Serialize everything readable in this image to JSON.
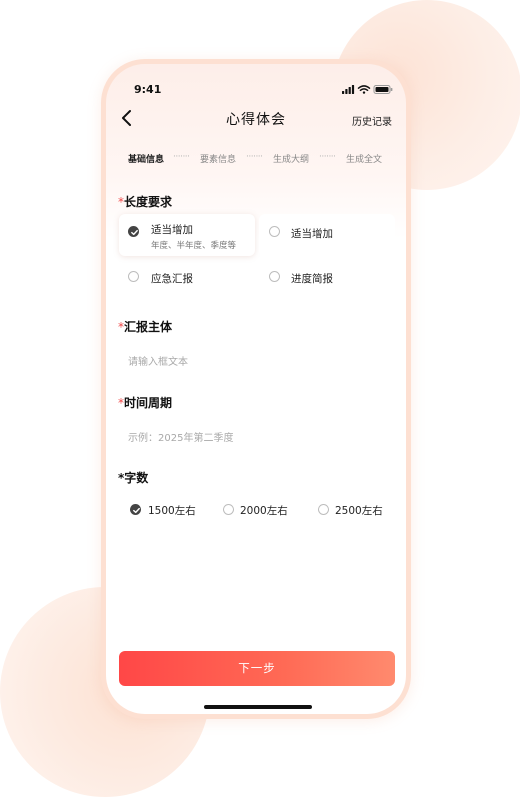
{
  "status": {
    "time": "9:41"
  },
  "nav": {
    "title": "心得体会",
    "history": "历史记录"
  },
  "steps": [
    {
      "label": "基础信息",
      "active": true
    },
    {
      "label": "要素信息",
      "active": false
    },
    {
      "label": "生成大纲",
      "active": false
    },
    {
      "label": "生成全文",
      "active": false
    }
  ],
  "step_separator": "·······",
  "required_mark": "*",
  "length": {
    "label": "长度要求",
    "options": [
      {
        "label": "适当增加",
        "sub": "年度、半年度、季度等",
        "selected": true
      },
      {
        "label": "适当增加",
        "selected": false
      },
      {
        "label": "应急汇报",
        "selected": false
      },
      {
        "label": "进度简报",
        "selected": false
      }
    ]
  },
  "subject": {
    "label": "汇报主体",
    "placeholder": "请输入框文本"
  },
  "period": {
    "label": "时间周期",
    "placeholder": "示例：2025年第二季度"
  },
  "wordcount": {
    "label": "字数",
    "options": [
      {
        "label": "1500左右",
        "selected": true
      },
      {
        "label": "2000左右",
        "selected": false
      },
      {
        "label": "2500左右",
        "selected": false
      }
    ]
  },
  "next_button": "下一步",
  "colors": {
    "accent": "#ff4747",
    "required": "#f04848",
    "phone_border": "#fde0d2"
  },
  "icons": [
    "back-chevron-icon",
    "signal-icon",
    "wifi-icon",
    "battery-icon",
    "check-icon"
  ]
}
